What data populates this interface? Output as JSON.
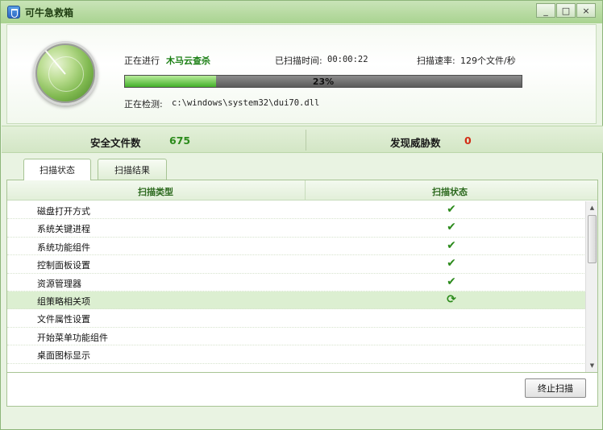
{
  "window": {
    "title": "可牛急救箱",
    "controls": {
      "minimize": "_",
      "maximize": "□",
      "close": "×"
    }
  },
  "scan": {
    "running_label": "正在进行",
    "running_task": "木马云查杀",
    "elapsed_label": "已扫描时间:",
    "elapsed_value": "00:00:22",
    "speed_label": "扫描速率:",
    "speed_value": "129个文件/秒",
    "progress_percent": 23,
    "progress_text": "23%",
    "checking_label": "正在检测:",
    "checking_path": "c:\\windows\\system32\\dui70.dll"
  },
  "stats": {
    "safe_label": "安全文件数",
    "safe_value": "675",
    "threat_label": "发现威胁数",
    "threat_value": "0",
    "safe_color": "#2b8a1b",
    "threat_color": "#d22b14"
  },
  "tabs": [
    {
      "label": "扫描状态",
      "active": true
    },
    {
      "label": "扫描结果",
      "active": false
    }
  ],
  "table": {
    "col_type": "扫描类型",
    "col_status": "扫描状态",
    "rows": [
      {
        "name": "磁盘打开方式",
        "status": "check-icon",
        "glyph": "✔"
      },
      {
        "name": "系统关键进程",
        "status": "check-icon",
        "glyph": "✔"
      },
      {
        "name": "系统功能组件",
        "status": "check-icon",
        "glyph": "✔"
      },
      {
        "name": "控制面板设置",
        "status": "check-icon",
        "glyph": "✔"
      },
      {
        "name": "资源管理器",
        "status": "check-icon",
        "glyph": "✔"
      },
      {
        "name": "组策略相关项",
        "status": "refresh-icon",
        "glyph": "⟳"
      },
      {
        "name": "文件属性设置",
        "status": "",
        "glyph": ""
      },
      {
        "name": "开始菜单功能组件",
        "status": "",
        "glyph": ""
      },
      {
        "name": "桌面图标显示",
        "status": "",
        "glyph": ""
      }
    ]
  },
  "buttons": {
    "stop": "终止扫描"
  }
}
